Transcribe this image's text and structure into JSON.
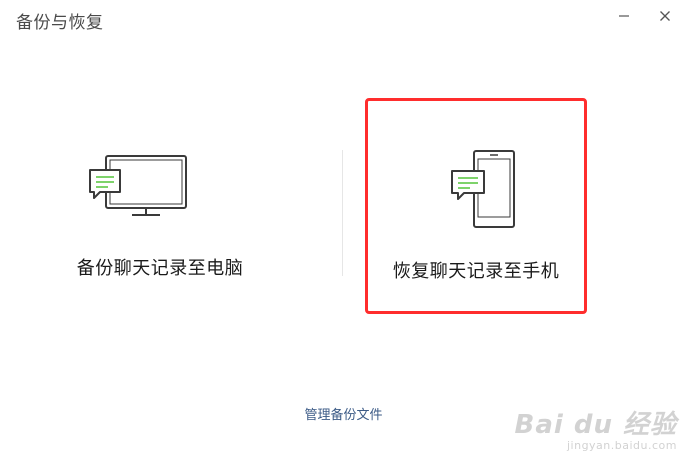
{
  "window": {
    "title": "备份与恢复",
    "minimize_icon": "minimize-icon",
    "close_icon": "close-icon"
  },
  "options": {
    "backup": {
      "label": "备份聊天记录至电脑",
      "icon": "monitor-chat-icon"
    },
    "restore": {
      "label": "恢复聊天记录至手机",
      "icon": "phone-chat-icon"
    }
  },
  "footer": {
    "manage_link": "管理备份文件"
  },
  "watermark": {
    "brand": "Bai du 经验",
    "url": "jingyan.baidu.com"
  },
  "colors": {
    "highlight_border": "#ff2d2d",
    "link": "#3b5a86",
    "chat_lines": "#7ed36b"
  }
}
